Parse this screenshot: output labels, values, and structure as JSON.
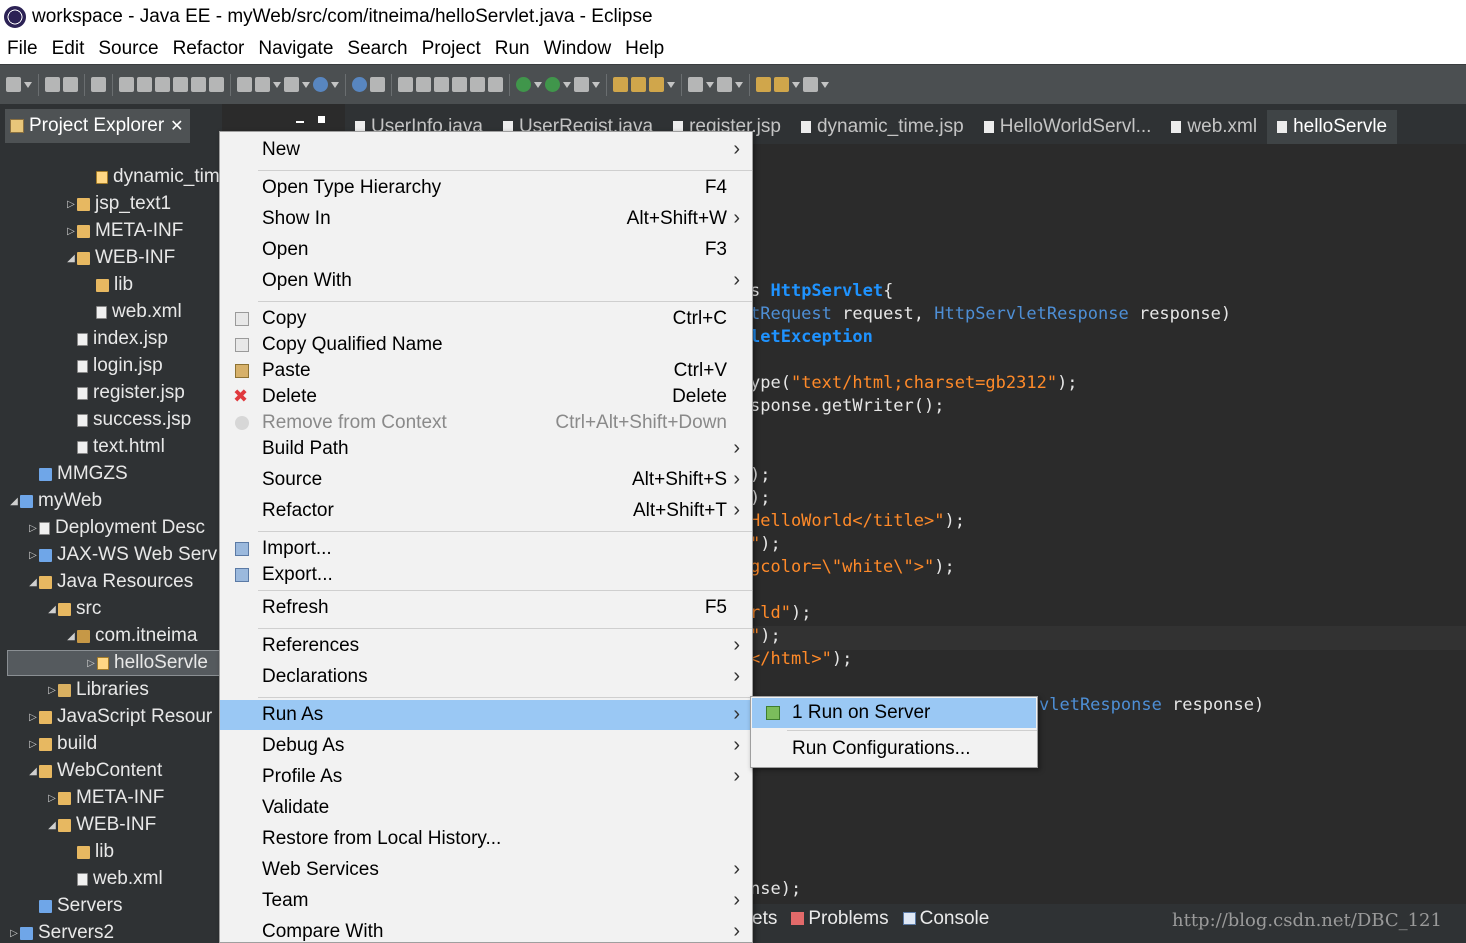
{
  "window": {
    "title": "workspace - Java EE - myWeb/src/com/itneima/helloServlet.java - Eclipse"
  },
  "menubar": [
    "File",
    "Edit",
    "Source",
    "Refactor",
    "Navigate",
    "Search",
    "Project",
    "Run",
    "Window",
    "Help"
  ],
  "project_explorer": {
    "tab_label": "Project Explorer",
    "close_glyph": "✕",
    "tree": [
      {
        "label": "dynamic_tim",
        "icon": "jsp-file-icon",
        "indent": 4,
        "twisty": ""
      },
      {
        "label": "jsp_text1",
        "icon": "folder-icon",
        "indent": 3,
        "twisty": "▷"
      },
      {
        "label": "META-INF",
        "icon": "folder-icon",
        "indent": 3,
        "twisty": "▷"
      },
      {
        "label": "WEB-INF",
        "icon": "folder-icon",
        "indent": 3,
        "twisty": "◢"
      },
      {
        "label": "lib",
        "icon": "folder-icon",
        "indent": 4,
        "twisty": ""
      },
      {
        "label": "web.xml",
        "icon": "xml-file-icon",
        "indent": 4,
        "twisty": ""
      },
      {
        "label": "index.jsp",
        "icon": "file-icon",
        "indent": 3,
        "twisty": ""
      },
      {
        "label": "login.jsp",
        "icon": "file-icon",
        "indent": 3,
        "twisty": ""
      },
      {
        "label": "register.jsp",
        "icon": "file-icon",
        "indent": 3,
        "twisty": ""
      },
      {
        "label": "success.jsp",
        "icon": "file-icon",
        "indent": 3,
        "twisty": ""
      },
      {
        "label": "text.html",
        "icon": "file-icon",
        "indent": 3,
        "twisty": ""
      },
      {
        "label": "MMGZS",
        "icon": "project-icon",
        "indent": 1,
        "twisty": ""
      },
      {
        "label": "myWeb",
        "icon": "project-icon",
        "indent": 0,
        "twisty": "◢"
      },
      {
        "label": "Deployment Desc",
        "icon": "deploy-icon",
        "indent": 1,
        "twisty": "▷"
      },
      {
        "label": "JAX-WS Web Serv",
        "icon": "ws-icon",
        "indent": 1,
        "twisty": "▷"
      },
      {
        "label": "Java Resources",
        "icon": "java-res-icon",
        "indent": 1,
        "twisty": "◢"
      },
      {
        "label": "src",
        "icon": "src-folder-icon",
        "indent": 2,
        "twisty": "◢"
      },
      {
        "label": "com.itneima",
        "icon": "package-icon",
        "indent": 3,
        "twisty": "◢"
      },
      {
        "label": "helloServle",
        "icon": "java-file-icon",
        "indent": 4,
        "twisty": "▷",
        "selected": true
      },
      {
        "label": "Libraries",
        "icon": "library-icon",
        "indent": 2,
        "twisty": "▷"
      },
      {
        "label": "JavaScript Resour",
        "icon": "js-res-icon",
        "indent": 1,
        "twisty": "▷"
      },
      {
        "label": "build",
        "icon": "folder-icon",
        "indent": 1,
        "twisty": "▷"
      },
      {
        "label": "WebContent",
        "icon": "folder-icon",
        "indent": 1,
        "twisty": "◢"
      },
      {
        "label": "META-INF",
        "icon": "folder-icon",
        "indent": 2,
        "twisty": "▷"
      },
      {
        "label": "WEB-INF",
        "icon": "folder-icon",
        "indent": 2,
        "twisty": "◢"
      },
      {
        "label": "lib",
        "icon": "folder-icon",
        "indent": 3,
        "twisty": ""
      },
      {
        "label": "web.xml",
        "icon": "xml-file-icon",
        "indent": 3,
        "twisty": ""
      },
      {
        "label": "Servers",
        "icon": "project-icon",
        "indent": 1,
        "twisty": ""
      },
      {
        "label": "Servers2",
        "icon": "project-icon",
        "indent": 0,
        "twisty": "▷"
      }
    ]
  },
  "editor_tabs": [
    {
      "label": "UserInfo.java",
      "active": false
    },
    {
      "label": "UserRegist.java",
      "active": false
    },
    {
      "label": "register.jsp",
      "active": false
    },
    {
      "label": "dynamic_time.jsp",
      "active": false
    },
    {
      "label": "HelloWorldServl...",
      "active": false
    },
    {
      "label": "web.xml",
      "active": false
    },
    {
      "label": "helloServle",
      "active": true
    }
  ],
  "code_lines": [
    {
      "parts": [
        {
          "t": "s ",
          "c": ""
        },
        {
          "t": "HttpServlet",
          "c": "c-cls"
        },
        {
          "t": "{",
          "c": ""
        }
      ]
    },
    {
      "parts": [
        {
          "t": "tRequest",
          "c": "c-type"
        },
        {
          "t": " request, ",
          "c": ""
        },
        {
          "t": "HttpServletResponse",
          "c": "c-type"
        },
        {
          "t": " response)",
          "c": ""
        }
      ]
    },
    {
      "parts": [
        {
          "t": "letException",
          "c": "c-cls"
        }
      ]
    },
    {
      "parts": []
    },
    {
      "parts": [
        {
          "t": "ype(",
          "c": ""
        },
        {
          "t": "\"text/html;charset=gb2312\"",
          "c": "c-str"
        },
        {
          "t": ");",
          "c": ""
        }
      ]
    },
    {
      "parts": [
        {
          "t": "sponse.getWriter();",
          "c": ""
        }
      ]
    },
    {
      "parts": []
    },
    {
      "parts": []
    },
    {
      "parts": [
        {
          "t": ");",
          "c": ""
        }
      ]
    },
    {
      "parts": [
        {
          "t": ");",
          "c": ""
        }
      ]
    },
    {
      "parts": [
        {
          "t": "HelloWorld</title>\"",
          "c": "c-str"
        },
        {
          "t": ");",
          "c": ""
        }
      ]
    },
    {
      "parts": [
        {
          "t": "\"",
          "c": "c-str"
        },
        {
          "t": ");",
          "c": ""
        }
      ]
    },
    {
      "parts": [
        {
          "t": "gcolor=\\\"white\\\">\"",
          "c": "c-str"
        },
        {
          "t": ");",
          "c": ""
        }
      ]
    },
    {
      "parts": []
    },
    {
      "parts": [
        {
          "t": "rld\"",
          "c": "c-str"
        },
        {
          "t": ");",
          "c": ""
        }
      ]
    },
    {
      "parts": [
        {
          "t": "\"",
          "c": "c-str"
        },
        {
          "t": ");",
          "c": ""
        }
      ]
    },
    {
      "parts": [
        {
          "t": "</html>\"",
          "c": "c-str"
        },
        {
          "t": ");",
          "c": ""
        }
      ]
    },
    {
      "parts": []
    },
    {
      "parts": []
    },
    {
      "parts": []
    },
    {
      "parts": []
    },
    {
      "parts": []
    },
    {
      "parts": []
    },
    {
      "parts": []
    },
    {
      "parts": []
    },
    {
      "parts": []
    },
    {
      "parts": [
        {
          "t": "nse);",
          "c": ""
        }
      ]
    }
  ],
  "code_side": {
    "parts": [
      {
        "t": "vletResponse",
        "c": "c-type"
      },
      {
        "t": " response)",
        "c": ""
      }
    ]
  },
  "context_menu": {
    "items": [
      {
        "label": "New",
        "shortcut": "",
        "arrow": true,
        "icon": "",
        "sep_after": true
      },
      {
        "label": "Open Type Hierarchy",
        "shortcut": "F4",
        "arrow": false,
        "icon": ""
      },
      {
        "label": "Show In",
        "shortcut": "Alt+Shift+W",
        "arrow": true,
        "icon": ""
      },
      {
        "label": "Open",
        "shortcut": "F3",
        "arrow": false,
        "icon": ""
      },
      {
        "label": "Open With",
        "shortcut": "",
        "arrow": true,
        "icon": "",
        "sep_after": true
      },
      {
        "label": "Copy",
        "shortcut": "Ctrl+C",
        "arrow": false,
        "icon": "copy"
      },
      {
        "label": "Copy Qualified Name",
        "shortcut": "",
        "arrow": false,
        "icon": "copy"
      },
      {
        "label": "Paste",
        "shortcut": "Ctrl+V",
        "arrow": false,
        "icon": "paste"
      },
      {
        "label": "Delete",
        "shortcut": "Delete",
        "arrow": false,
        "icon": "delete"
      },
      {
        "label": "Remove from Context",
        "shortcut": "Ctrl+Alt+Shift+Down",
        "arrow": false,
        "icon": "rmctx",
        "disabled": true
      },
      {
        "label": "Build Path",
        "shortcut": "",
        "arrow": true,
        "icon": ""
      },
      {
        "label": "Source",
        "shortcut": "Alt+Shift+S",
        "arrow": true,
        "icon": ""
      },
      {
        "label": "Refactor",
        "shortcut": "Alt+Shift+T",
        "arrow": true,
        "icon": "",
        "sep_after": true
      },
      {
        "label": "Import...",
        "shortcut": "",
        "arrow": false,
        "icon": "import"
      },
      {
        "label": "Export...",
        "shortcut": "",
        "arrow": false,
        "icon": "export",
        "sep_after": true
      },
      {
        "label": "Refresh",
        "shortcut": "F5",
        "arrow": false,
        "icon": "",
        "sep_after": true
      },
      {
        "label": "References",
        "shortcut": "",
        "arrow": true,
        "icon": ""
      },
      {
        "label": "Declarations",
        "shortcut": "",
        "arrow": true,
        "icon": "",
        "sep_after": true
      },
      {
        "label": "Run As",
        "shortcut": "",
        "arrow": true,
        "icon": "",
        "highlighted": true
      },
      {
        "label": "Debug As",
        "shortcut": "",
        "arrow": true,
        "icon": ""
      },
      {
        "label": "Profile As",
        "shortcut": "",
        "arrow": true,
        "icon": ""
      },
      {
        "label": "Validate",
        "shortcut": "",
        "arrow": false,
        "icon": ""
      },
      {
        "label": "Restore from Local History...",
        "shortcut": "",
        "arrow": false,
        "icon": ""
      },
      {
        "label": "Web Services",
        "shortcut": "",
        "arrow": true,
        "icon": ""
      },
      {
        "label": "Team",
        "shortcut": "",
        "arrow": true,
        "icon": ""
      },
      {
        "label": "Compare With",
        "shortcut": "",
        "arrow": true,
        "icon": ""
      }
    ]
  },
  "run_as_submenu": {
    "items": [
      {
        "label": "1 Run on Server",
        "icon": "run-server-icon",
        "highlighted": true
      },
      {
        "label": "Run Configurations...",
        "icon": ""
      }
    ]
  },
  "bottom_views": {
    "partial_tab": "ets",
    "tabs": [
      "Problems",
      "Console"
    ]
  },
  "watermark": "http://blog.csdn.net/DBC_121"
}
